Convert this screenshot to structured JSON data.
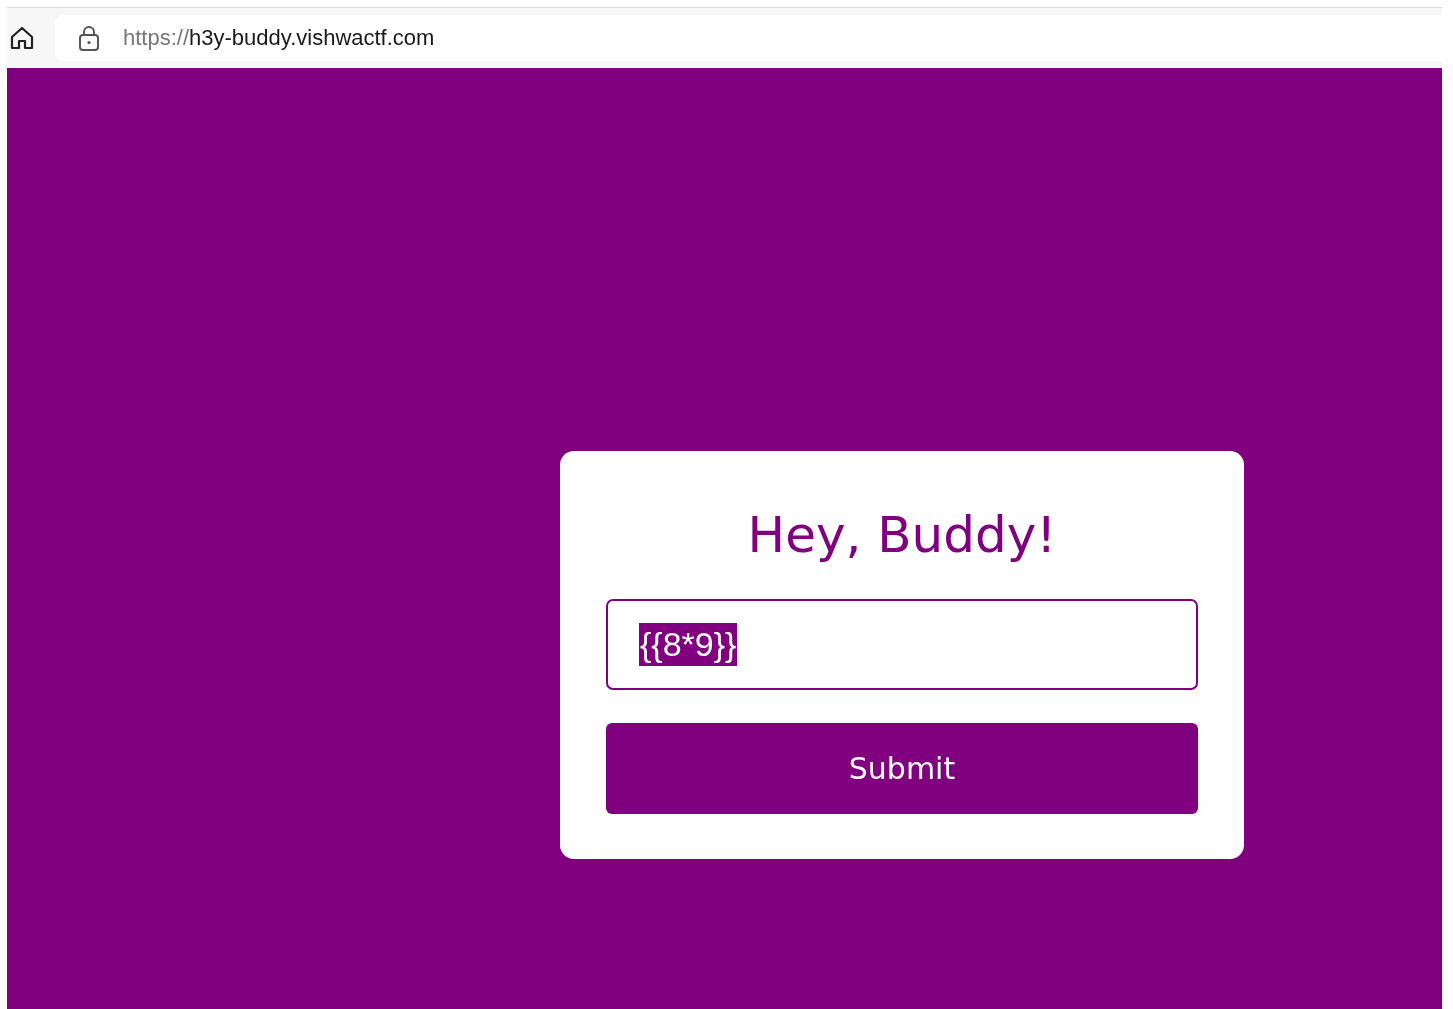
{
  "browser": {
    "address_scheme": "https://",
    "address_host": "h3y-buddy.vishwactf.com"
  },
  "form": {
    "title": "Hey, Buddy!",
    "input": {
      "value": "{{8*9}}",
      "selected": true
    },
    "button": "Submit"
  }
}
